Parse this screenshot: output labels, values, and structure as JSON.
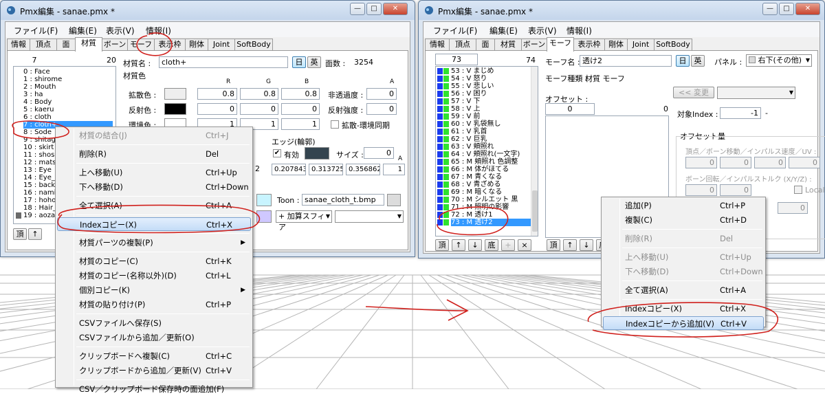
{
  "left_window": {
    "title": "Pmx編集 - sanae.pmx *",
    "menu": [
      "ファイル(F)",
      "編集(E)",
      "表示(V)",
      "情報(I)"
    ],
    "tabs": [
      "情報",
      "頂点",
      "面",
      "材質",
      "ボーン",
      "モーフ",
      "表示枠",
      "剛体",
      "Joint",
      "SoftBody"
    ],
    "list_index": "7",
    "list_count": "20",
    "list_items": [
      "0 : Face",
      "1 : shirome",
      "2 : Mouth",
      "3 : ha",
      "4 : Body",
      "5 : kaeru",
      "6 : cloth",
      "7 : cloth+",
      "8 : Sode",
      "9 : shitagi",
      "10 : skirt",
      "11 : shose",
      "12 : matsu",
      "13 : Eye",
      "14 : Eye_h",
      "15 : back_",
      "16 : namid",
      "17 : hoho_",
      "18 : Hair_",
      "19 : aozar"
    ],
    "nav_buttons": [
      "頂",
      "↑"
    ],
    "material_name_label": "材質名 :",
    "material_name": "cloth+",
    "jp_btn": "日",
    "en_btn": "英",
    "face_count_label": "面数 :",
    "face_count": "3254",
    "color_section": "材質色",
    "col_r": "R",
    "col_g": "G",
    "col_b": "B",
    "col_a": "A",
    "diffuse_label": "拡散色 :",
    "diffuse": [
      "0.8",
      "0.8",
      "0.8"
    ],
    "specular_label": "反射色 :",
    "specular": [
      "0",
      "0",
      "0"
    ],
    "ambient_label": "環境色 :",
    "ambient": [
      "1",
      "1",
      "1"
    ],
    "opacity_label": "非透過度 :",
    "opacity": "0",
    "reflect_label": "反射強度 :",
    "reflect": "0",
    "sync_label": "拡散-環境同期",
    "edge_label": "エッジ(輪郭)",
    "edge_enabled": "有効",
    "edge_size_label": "サイズ :",
    "edge_size": "0",
    "edge_a": "A",
    "edge_values": [
      "0.207843",
      "0.313725",
      "0.356862",
      "1"
    ],
    "partial_value": "2",
    "toon_label": "Toon :",
    "toon_file": "sanae_cloth_t.bmp",
    "sphere_mode": "+ 加算スフィア",
    "context_menu": [
      {
        "label": "材質の結合(J)",
        "shortcut": "Ctrl+J",
        "disabled": true
      },
      {
        "sep": true
      },
      {
        "label": "削除(R)",
        "shortcut": "Del"
      },
      {
        "sep": true
      },
      {
        "label": "上へ移動(U)",
        "shortcut": "Ctrl+Up"
      },
      {
        "label": "下へ移動(D)",
        "shortcut": "Ctrl+Down"
      },
      {
        "sep": true
      },
      {
        "label": "全て選択(A)",
        "shortcut": "Ctrl+A"
      },
      {
        "sep": true
      },
      {
        "label": "Indexコピー(X)",
        "shortcut": "Ctrl+X",
        "highlight": true
      },
      {
        "sep": true
      },
      {
        "label": "材質パーツの複製(P)",
        "shortcut": "",
        "submenu": true
      },
      {
        "sep": true
      },
      {
        "label": "材質のコピー(C)",
        "shortcut": "Ctrl+K"
      },
      {
        "label": "材質のコピー(名称以外)(D)",
        "shortcut": "Ctrl+L"
      },
      {
        "label": "個別コピー(K)",
        "shortcut": "",
        "submenu": true
      },
      {
        "label": "材質の貼り付け(P)",
        "shortcut": "Ctrl+P"
      },
      {
        "sep": true
      },
      {
        "label": "CSVファイルへ保存(S)",
        "shortcut": ""
      },
      {
        "label": "CSVファイルから追加／更新(O)",
        "shortcut": ""
      },
      {
        "sep": true
      },
      {
        "label": "クリップボードへ複製(C)",
        "shortcut": "Ctrl+C"
      },
      {
        "label": "クリップボードから追加／更新(V)",
        "shortcut": "Ctrl+V"
      },
      {
        "sep": true
      },
      {
        "label": "CSV／クリップボード保存時の面追加(F)",
        "shortcut": ""
      }
    ]
  },
  "right_window": {
    "title": "Pmx編集 - sanae.pmx *",
    "menu": [
      "ファイル(F)",
      "編集(E)",
      "表示(V)",
      "情報(I)"
    ],
    "tabs": [
      "情報",
      "頂点",
      "面",
      "材質",
      "ボーン",
      "モーフ",
      "表示枠",
      "剛体",
      "Joint",
      "SoftBody"
    ],
    "list_index": "73",
    "list_count": "74",
    "list_items": [
      "53 : V まじめ",
      "54 : V 怒り",
      "55 : V 悲しい",
      "56 : V 困り",
      "57 : V 下",
      "58 : V 上",
      "59 : V 前",
      "60 : V 乳袋無し",
      "61 : V 乳首",
      "62 : V 巨乳",
      "63 : V 頬照れ",
      "64 : V 頬照れ(一文字)",
      "65 : M 頬照れ 色調整",
      "66 : M 体がほてる",
      "67 : M 青くなる",
      "68 : V 青ざめる",
      "69 : M 暗くなる",
      "70 : M シルエット 黒",
      "71 : M 照明の影響",
      "72 : M 透け1",
      "73 : M 透け2"
    ],
    "nav_buttons": [
      "頂",
      "↑",
      "↓",
      "底",
      "+",
      "×"
    ],
    "morph_name_label": "モーフ名 :",
    "morph_name": "透け2",
    "jp_btn": "日",
    "en_btn": "英",
    "panel_label": "パネル :",
    "panel_value": "右下(その他)",
    "morph_type_label": "モーフ種類 :",
    "morph_type": "材質 モーフ",
    "change_btn": "<< 変更",
    "offset_label": "オフセット :",
    "offset_index": "0",
    "offset_count": "0",
    "target_index_label": "対象Index :",
    "target_index": "-1",
    "target_dash": "-",
    "offset_amount_label": "オフセット量",
    "vertex_label": "頂点／ボーン移動／インパルス速度／UV :",
    "vertex_values": [
      "0",
      "0",
      "0",
      "0"
    ],
    "rotation_label": "ボーン回転／インパルストルク (X/Y/Z) :",
    "rotation_values": [
      "0",
      "0"
    ],
    "local_label": "Local",
    "extra_value": "0",
    "bottom_nav": [
      "頂",
      "↑",
      "↓",
      "底"
    ],
    "context_menu": [
      {
        "label": "追加(P)",
        "shortcut": "Ctrl+P"
      },
      {
        "label": "複製(C)",
        "shortcut": "Ctrl+D"
      },
      {
        "sep": true
      },
      {
        "label": "削除(R)",
        "shortcut": "Del",
        "disabled": true
      },
      {
        "sep": true
      },
      {
        "label": "上へ移動(U)",
        "shortcut": "Ctrl+Up",
        "disabled": true
      },
      {
        "label": "下へ移動(D)",
        "shortcut": "Ctrl+Down",
        "disabled": true
      },
      {
        "sep": true
      },
      {
        "label": "全て選択(A)",
        "shortcut": "Ctrl+A"
      },
      {
        "sep": true
      },
      {
        "label": "Indexコピー(X)",
        "shortcut": "Ctrl+X"
      },
      {
        "label": "Indexコピーから追加(V)",
        "shortcut": "Ctrl+V",
        "highlight": true
      }
    ]
  },
  "colors": {
    "selection": "#3399ff",
    "annotation": "#d0201c",
    "menu_highlight": "#c4dcf7"
  }
}
